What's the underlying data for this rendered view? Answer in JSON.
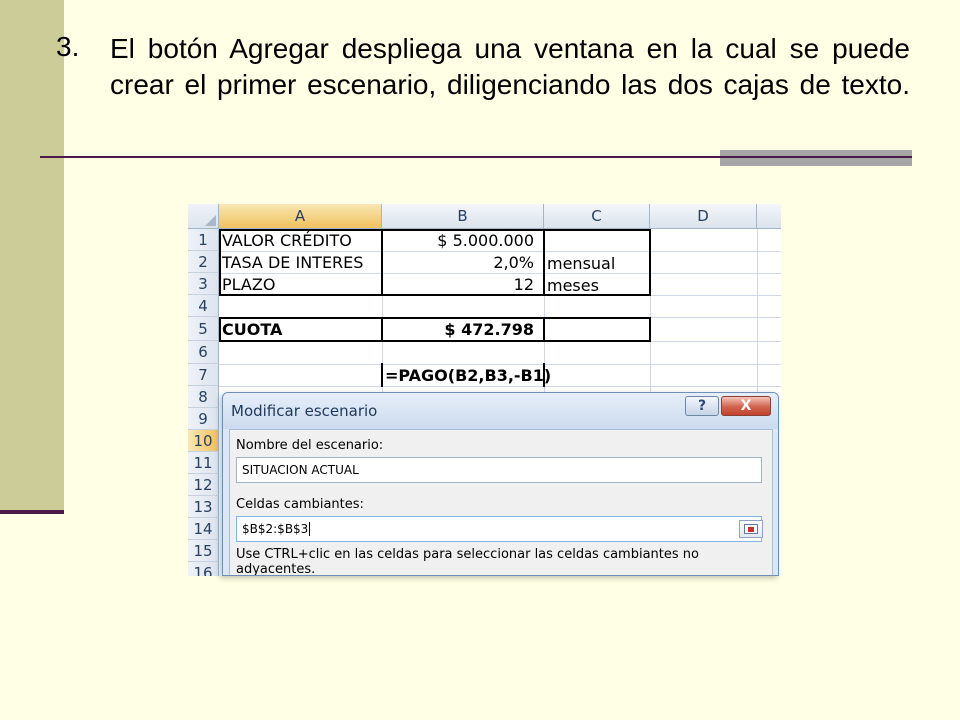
{
  "slide": {
    "bullet_number": "3.",
    "bullet_text": "El botón Agregar despliega una ventana en la cual se puede crear el primer escenario, diligenciando las dos cajas de texto."
  },
  "spreadsheet": {
    "columns": [
      "A",
      "B",
      "C",
      "D"
    ],
    "rows": [
      "1",
      "2",
      "3",
      "4",
      "5",
      "6",
      "7",
      "8",
      "9",
      "10",
      "11",
      "12",
      "13",
      "14",
      "15",
      "16"
    ],
    "selected_row": "10",
    "cells": {
      "a1": "VALOR CRÉDITO",
      "b1": "$ 5.000.000",
      "a2": "TASA DE INTERES",
      "b2": "2,0%",
      "c2": "mensual",
      "a3": "PLAZO",
      "b3": "12",
      "c3": "meses",
      "a5": "CUOTA",
      "b5": "$ 472.798",
      "b7": "=PAGO(B2,B3,-B1)"
    }
  },
  "dialog": {
    "title": "Modificar escenario",
    "help_label": "?",
    "close_label": "X",
    "name_label": "Nombre del escenario:",
    "name_value": "SITUACION ACTUAL",
    "cells_label": "Celdas cambiantes:",
    "cells_value": "$B$2:$B$3",
    "hint": "Use CTRL+clic en las celdas para seleccionar las celdas cambiantes no adyacentes."
  },
  "colors": {
    "background": "#FFFFE5",
    "left_bar": "#CCCC99",
    "rule": "#4B1A4B",
    "accent": "#A6A6A6"
  }
}
